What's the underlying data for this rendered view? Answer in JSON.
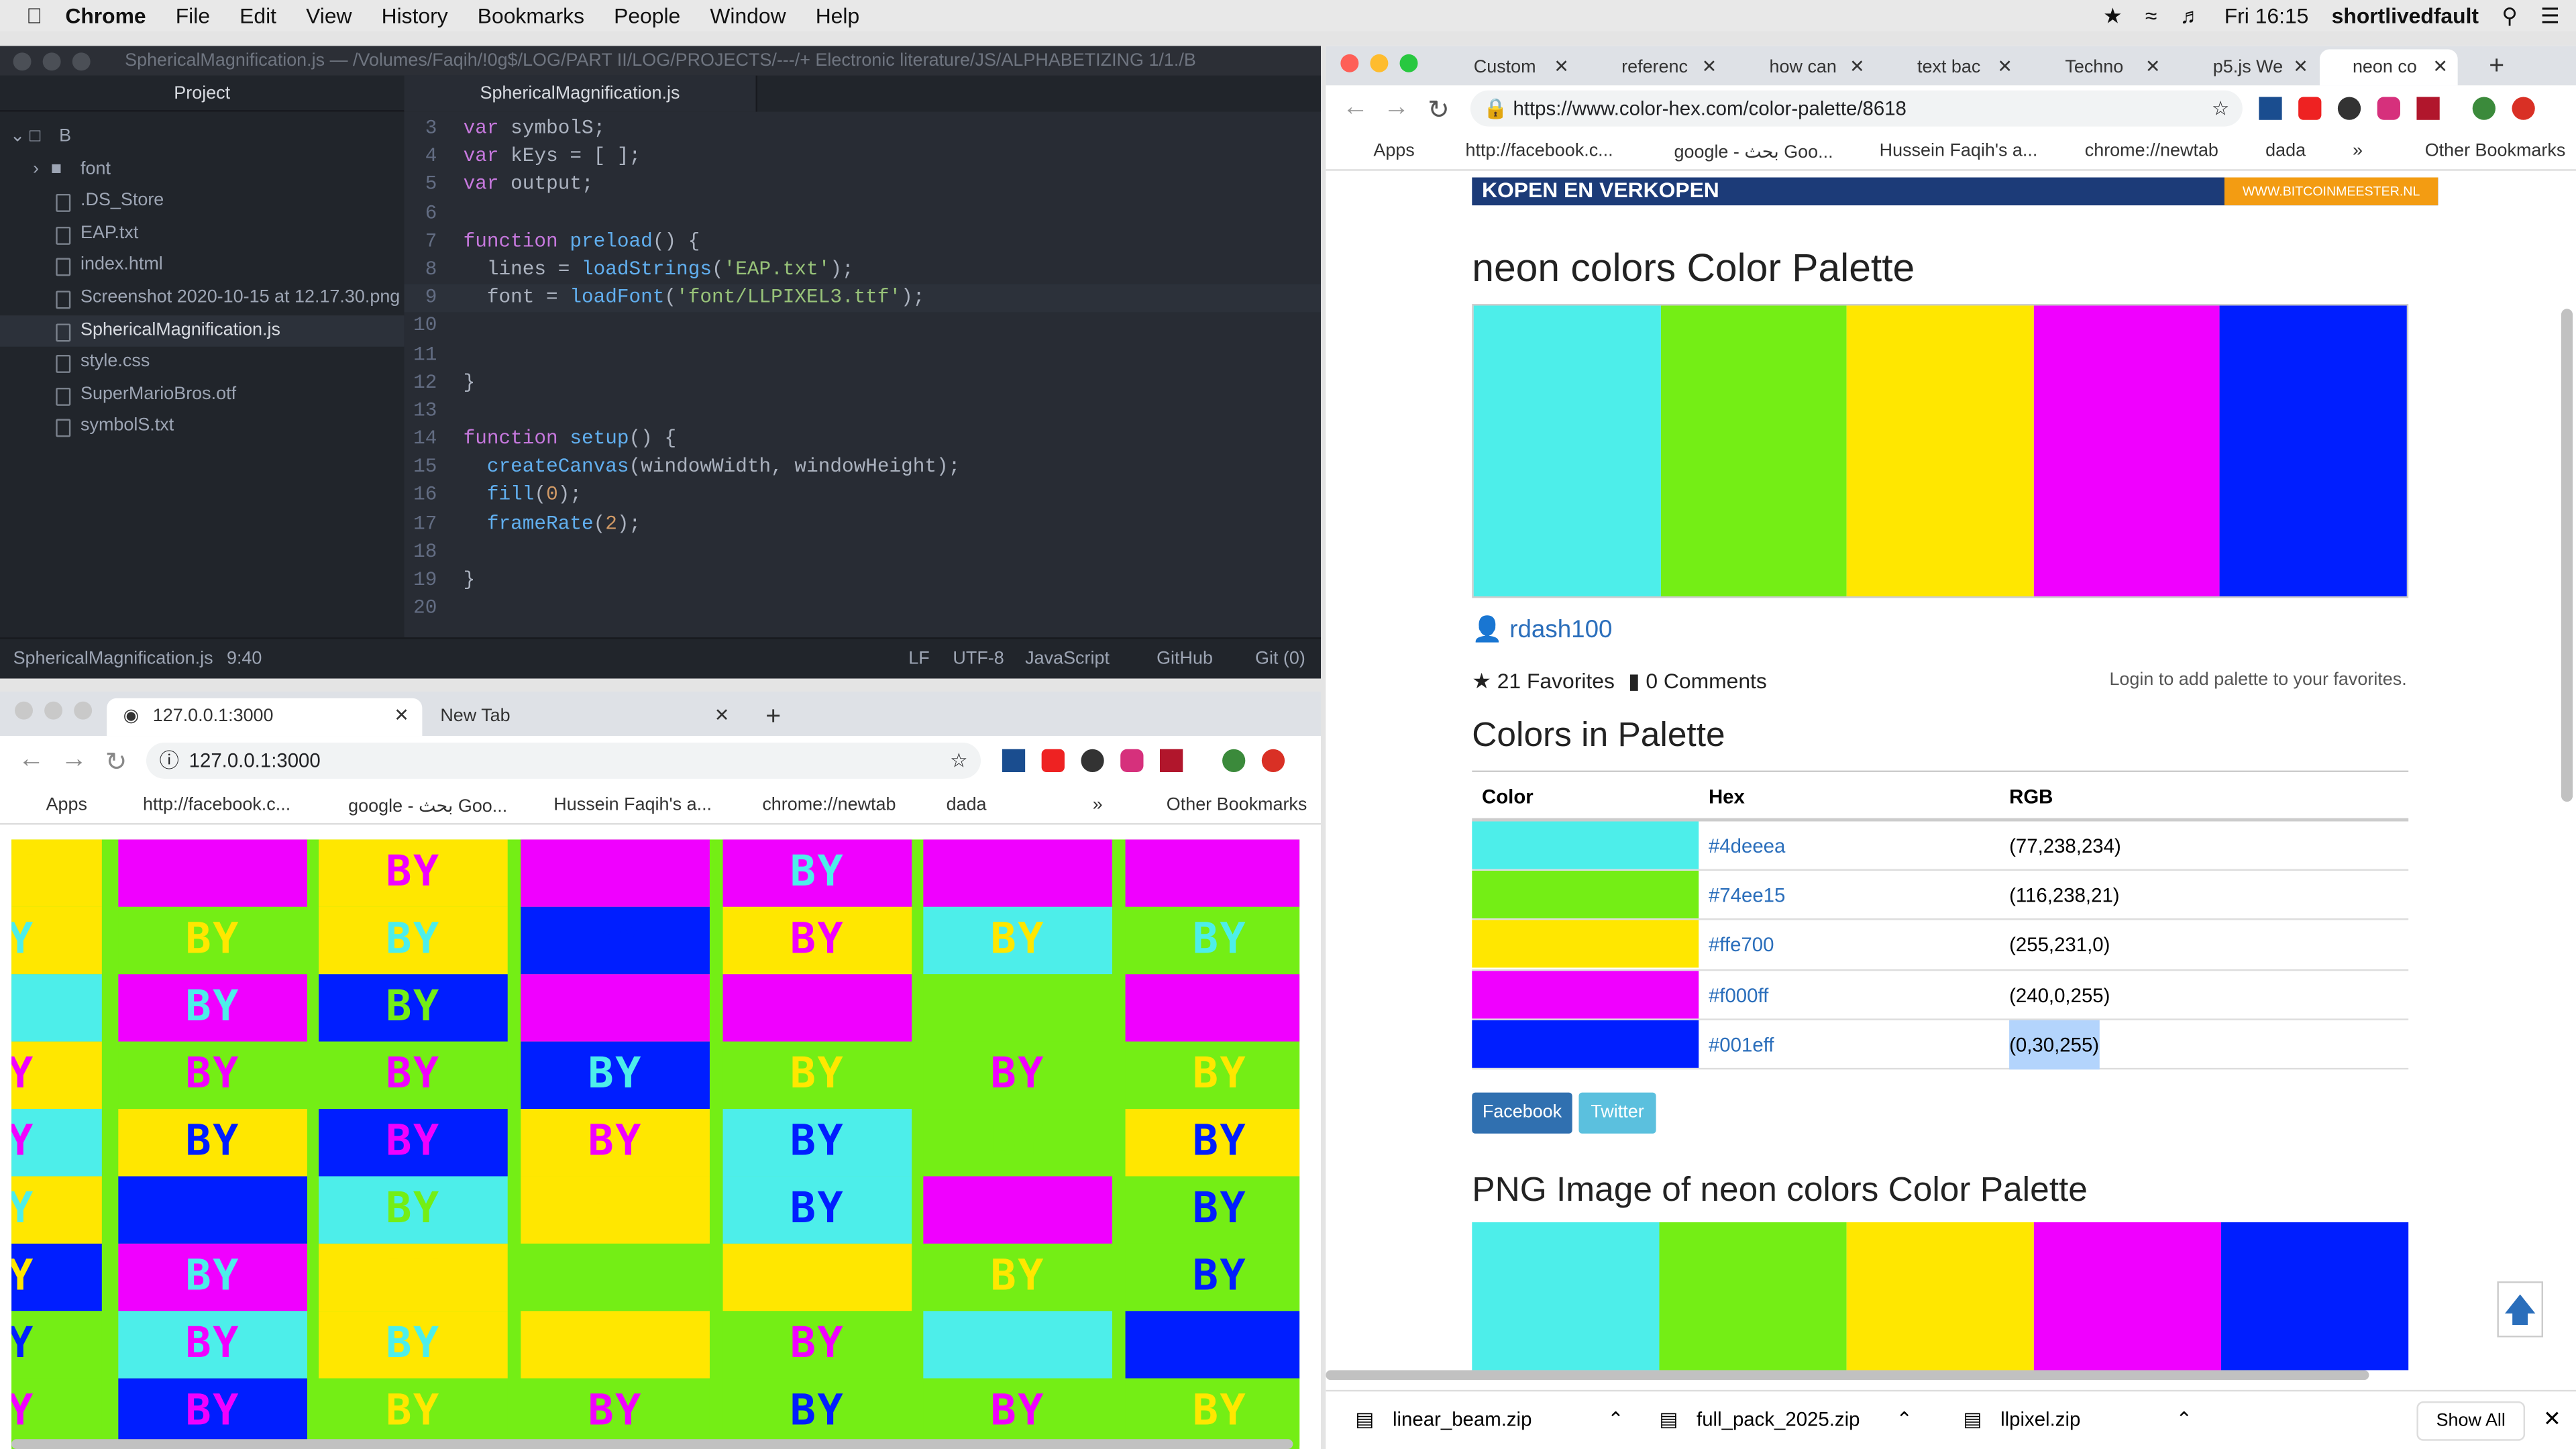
{
  "menubar": {
    "app": "Chrome",
    "items": [
      "File",
      "Edit",
      "View",
      "History",
      "Bookmarks",
      "People",
      "Window",
      "Help"
    ],
    "clock": "Fri 16:15",
    "user": "shortlivedfault"
  },
  "atom": {
    "title": "SphericalMagnification.js — /Volumes/Faqih/!0g$/LOG/PART II/LOG/PROJECTS/---/+ Electronic literature/JS/ALPHABETIZING 1/1./B",
    "project_header": "Project",
    "tab": "SphericalMagnification.js",
    "tree": [
      "B",
      "font",
      ".DS_Store",
      "EAP.txt",
      "index.html",
      "Screenshot 2020-10-15 at 12.17.30.png",
      "SphericalMagnification.js",
      "style.css",
      "SuperMarioBros.otf",
      "symbolS.txt"
    ],
    "status": {
      "file": "SphericalMagnification.js",
      "pos": "9:40",
      "lf": "LF",
      "enc": "UTF-8",
      "lang": "JavaScript",
      "github": "GitHub",
      "git": "Git (0)"
    },
    "code_lines": [
      "3",
      "4",
      "5",
      "6",
      "7",
      "8",
      "9",
      "10",
      "11",
      "12",
      "13",
      "14",
      "15",
      "16",
      "17",
      "18",
      "19",
      "20"
    ]
  },
  "p5browser": {
    "tab_active": "127.0.0.1:3000",
    "tab_new": "New Tab",
    "url": "127.0.0.1:3000",
    "bookmarks": [
      "Apps",
      "http://facebook.c...",
      "google - بحث Goo...",
      "Hussein Faqih's a...",
      "chrome://newtab",
      "dada"
    ],
    "other": "Other Bookmarks",
    "grid_text": "BY"
  },
  "rightbrowser": {
    "tabs": [
      "Custom",
      "referenc",
      "how can",
      "text bac",
      "Techno",
      "p5.js We",
      "neon co"
    ],
    "url": "https://www.color-hex.com/color-palette/8618",
    "bookmarks": [
      "Apps",
      "http://facebook.c...",
      "google - بحث Goo...",
      "Hussein Faqih's a...",
      "chrome://newtab",
      "dada"
    ],
    "other": "Other Bookmarks",
    "banner": "KOPEN EN VERKOPEN",
    "banner_right": "WWW.BITCOINMEESTER.NL",
    "title": "neon colors Color Palette",
    "author": "rdash100",
    "favorites": "21 Favorites",
    "comments": "0 Comments",
    "login": "Login to add palette to your favorites.",
    "colors_heading": "Colors in Palette",
    "th": [
      "Color",
      "Hex",
      "RGB"
    ],
    "rows": [
      {
        "color": "#4deeea",
        "hex": "#4deeea",
        "rgb": "(77,238,234)"
      },
      {
        "color": "#74ee15",
        "hex": "#74ee15",
        "rgb": "(116,238,21)"
      },
      {
        "color": "#ffe700",
        "hex": "#ffe700",
        "rgb": "(255,231,0)"
      },
      {
        "color": "#f000ff",
        "hex": "#f000ff",
        "rgb": "(240,0,255)"
      },
      {
        "color": "#001eff",
        "hex": "#001eff",
        "rgb": "(0,30,255)"
      }
    ],
    "facebook": "Facebook",
    "twitter": "Twitter",
    "png_heading": "PNG Image of neon colors Color Palette",
    "downloads": [
      "linear_beam.zip",
      "full_pack_2025.zip",
      "llpixel.zip"
    ],
    "show_all": "Show All"
  }
}
